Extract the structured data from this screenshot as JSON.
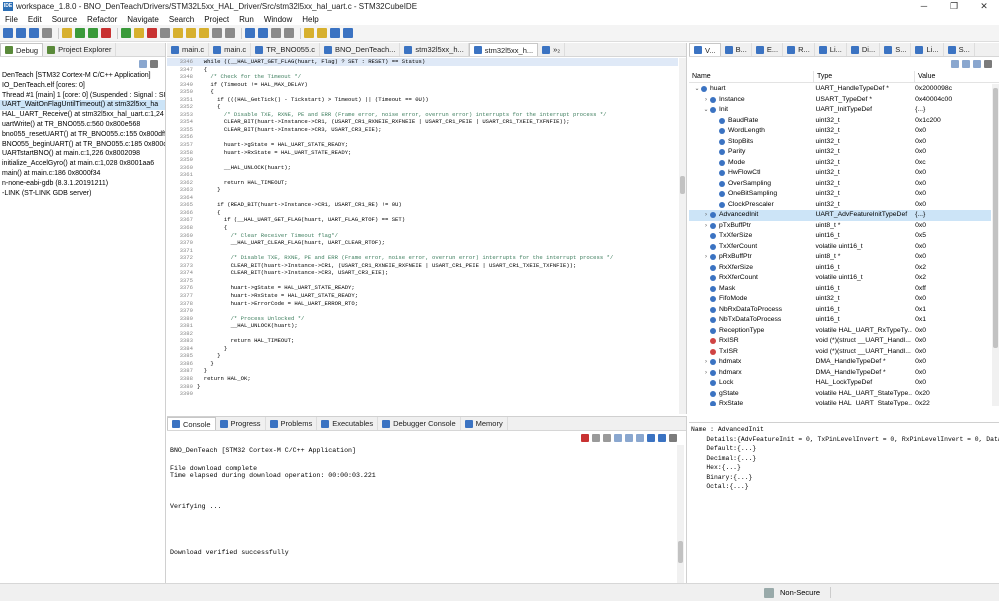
{
  "window": {
    "title": "workspace_1.8.0 - BNO_DenTeach/Drivers/STM32L5xx_HAL_Driver/Src/stm32l5xx_hal_uart.c - STM32CubeIDE",
    "app_icon": "IDE",
    "minimize": "─",
    "maximize": "❐",
    "close": "✕"
  },
  "menu": [
    "File",
    "Edit",
    "Source",
    "Refactor",
    "Navigate",
    "Search",
    "Project",
    "Run",
    "Window",
    "Help"
  ],
  "toolbar": {
    "icons": [
      "new-icon",
      "save-icon",
      "save-all-icon",
      "print-icon",
      "build-icon",
      "debug-icon",
      "run-icon",
      "external-tools-icon",
      "resume-icon",
      "suspend-icon",
      "terminate-icon",
      "disconnect-icon",
      "step-into-icon",
      "step-over-icon",
      "step-return-icon",
      "instruction-step-icon",
      "drop-frame-icon",
      "search-icon",
      "open-type-icon",
      "next-annotation-icon",
      "prev-annotation-icon",
      "back-icon",
      "forward-icon",
      "pin-icon",
      "info-icon"
    ],
    "colors": {
      "green": "#3a9a3a",
      "blue": "#3b73c2",
      "red": "#c83232",
      "yellow": "#d7b02e",
      "gray": "#8a8a8a"
    }
  },
  "debug_pane": {
    "tabs": [
      {
        "label": "Debug",
        "active": true
      },
      {
        "label": "Project Explorer",
        "active": false
      }
    ],
    "lines": [
      {
        "text": "DenTeach [STM32 Cortex-M C/C++ Application]",
        "selected": false
      },
      {
        "text": "IO_DenTeach.elf [cores: 0]",
        "selected": false
      },
      {
        "text": "Thread #1 [main] 1 [core: 0] (Suspended : Signal : SIG",
        "selected": false
      },
      {
        "text": "UART_WaitOnFlagUntilTimeout() at stm32l5xx_ha",
        "selected": true
      },
      {
        "text": "HAL_UART_Receive() at stm32l5xx_hal_uart.c:1,24",
        "selected": false
      },
      {
        "text": "uartWrite() at TR_BNO055.c:560 0x800e568",
        "selected": false
      },
      {
        "text": "bno055_resetUART() at TR_BNO055.c:155 0x800df5",
        "selected": false
      },
      {
        "text": "BNO055_beginUART() at TR_BNO055.c:185 0x800c",
        "selected": false
      },
      {
        "text": "UARTstartBNO() at main.c:1,226 0x8002098",
        "selected": false
      },
      {
        "text": "initialize_AccelGyro() at main.c:1,028 0x8001aa6",
        "selected": false
      },
      {
        "text": "main() at main.c:186 0x8000f34",
        "selected": false
      },
      {
        "text": "n-none-eabi-gdb (8.3.1.20191211)",
        "selected": false
      },
      {
        "text": "-LINK (ST-LINK GDB server)",
        "selected": false
      }
    ]
  },
  "editor": {
    "tabs": [
      {
        "label": "main.c",
        "active": false
      },
      {
        "label": "main.c",
        "active": false
      },
      {
        "label": "TR_BNO055.c",
        "active": false
      },
      {
        "label": "BNO_DenTeach...",
        "active": false
      },
      {
        "label": "stm32l5xx_h...",
        "active": false
      },
      {
        "label": "stm32l5xx_h...",
        "active": true
      },
      {
        "label": "»₂",
        "active": false
      }
    ],
    "lines": [
      {
        "n": "3346",
        "t": "  while ((__HAL_UART_GET_FLAG(huart, Flag) ? SET : RESET) == Status)",
        "hl": true
      },
      {
        "n": "3347",
        "t": "  {",
        "hl": false
      },
      {
        "n": "3348",
        "t": "    /* Check for the Timeout */",
        "hl": false
      },
      {
        "n": "3349",
        "t": "    if (Timeout != HAL_MAX_DELAY)",
        "hl": false
      },
      {
        "n": "3350",
        "t": "    {",
        "hl": false
      },
      {
        "n": "3351",
        "t": "      if (((HAL_GetTick() - Tickstart) > Timeout) || (Timeout == 0U))",
        "hl": false
      },
      {
        "n": "3352",
        "t": "      {",
        "hl": false
      },
      {
        "n": "3353",
        "t": "        /* Disable TXE, RXNE, PE and ERR (Frame error, noise error, overrun error) interrupts for the interrupt process */",
        "hl": false
      },
      {
        "n": "3354",
        "t": "        CLEAR_BIT(huart->Instance->CR1, (USART_CR1_RXNEIE_RXFNEIE | USART_CR1_PEIE | USART_CR1_TXEIE_TXFNFIE));",
        "hl": false
      },
      {
        "n": "3355",
        "t": "        CLEAR_BIT(huart->Instance->CR3, USART_CR3_EIE);",
        "hl": false
      },
      {
        "n": "3356",
        "t": "",
        "hl": false
      },
      {
        "n": "3357",
        "t": "        huart->gState = HAL_UART_STATE_READY;",
        "hl": false
      },
      {
        "n": "3358",
        "t": "        huart->RxState = HAL_UART_STATE_READY;",
        "hl": false
      },
      {
        "n": "3359",
        "t": "",
        "hl": false
      },
      {
        "n": "3360",
        "t": "        __HAL_UNLOCK(huart);",
        "hl": false
      },
      {
        "n": "3361",
        "t": "",
        "hl": false
      },
      {
        "n": "3362",
        "t": "        return HAL_TIMEOUT;",
        "hl": false
      },
      {
        "n": "3363",
        "t": "      }",
        "hl": false
      },
      {
        "n": "3364",
        "t": "",
        "hl": false
      },
      {
        "n": "3365",
        "t": "      if (READ_BIT(huart->Instance->CR1, USART_CR1_RE) != 0U)",
        "hl": false
      },
      {
        "n": "3366",
        "t": "      {",
        "hl": false
      },
      {
        "n": "3367",
        "t": "        if (__HAL_UART_GET_FLAG(huart, UART_FLAG_RTOF) == SET)",
        "hl": false
      },
      {
        "n": "3368",
        "t": "        {",
        "hl": false
      },
      {
        "n": "3369",
        "t": "          /* Clear Receiver Timeout flag*/",
        "hl": false
      },
      {
        "n": "3370",
        "t": "          __HAL_UART_CLEAR_FLAG(huart, UART_CLEAR_RTOF);",
        "hl": false
      },
      {
        "n": "3371",
        "t": "",
        "hl": false
      },
      {
        "n": "3372",
        "t": "          /* Disable TXE, RXNE, PE and ERR (Frame error, noise error, overrun error) interrupts for the interrupt process */",
        "hl": false
      },
      {
        "n": "3373",
        "t": "          CLEAR_BIT(huart->Instance->CR1, (USART_CR1_RXNEIE_RXFNEIE | USART_CR1_PEIE | USART_CR1_TXEIE_TXFNFIE));",
        "hl": false
      },
      {
        "n": "3374",
        "t": "          CLEAR_BIT(huart->Instance->CR3, USART_CR3_EIE);",
        "hl": false
      },
      {
        "n": "3375",
        "t": "",
        "hl": false
      },
      {
        "n": "3376",
        "t": "          huart->gState = HAL_UART_STATE_READY;",
        "hl": false
      },
      {
        "n": "3377",
        "t": "          huart->RxState = HAL_UART_STATE_READY;",
        "hl": false
      },
      {
        "n": "3378",
        "t": "          huart->ErrorCode = HAL_UART_ERROR_RTO;",
        "hl": false
      },
      {
        "n": "3379",
        "t": "",
        "hl": false
      },
      {
        "n": "3380",
        "t": "          /* Process Unlocked */",
        "hl": false
      },
      {
        "n": "3381",
        "t": "          __HAL_UNLOCK(huart);",
        "hl": false
      },
      {
        "n": "3382",
        "t": "",
        "hl": false
      },
      {
        "n": "3383",
        "t": "          return HAL_TIMEOUT;",
        "hl": false
      },
      {
        "n": "3384",
        "t": "        }",
        "hl": false
      },
      {
        "n": "3385",
        "t": "      }",
        "hl": false
      },
      {
        "n": "3386",
        "t": "    }",
        "hl": false
      },
      {
        "n": "3387",
        "t": "  }",
        "hl": false
      },
      {
        "n": "3388",
        "t": "  return HAL_OK;",
        "hl": false
      },
      {
        "n": "3389",
        "t": "}",
        "hl": false
      },
      {
        "n": "3390",
        "t": "",
        "hl": false
      }
    ]
  },
  "console": {
    "tabs": [
      {
        "label": "Console",
        "active": true
      },
      {
        "label": "Progress",
        "active": false
      },
      {
        "label": "Problems",
        "active": false
      },
      {
        "label": "Executables",
        "active": false
      },
      {
        "label": "Debugger Console",
        "active": false
      },
      {
        "label": "Memory",
        "active": false
      }
    ],
    "header": "BNO_DenTeach [STM32 Cortex-M C/C++ Application]",
    "lines": [
      "",
      "File download complete",
      "Time elapsed during download operation: 00:00:03.221",
      "",
      "",
      "",
      "Verifying ...",
      "",
      "",
      "",
      "",
      "",
      "Download verified successfully",
      ""
    ]
  },
  "variables": {
    "tabs": [
      {
        "label": "V...",
        "active": true
      },
      {
        "label": "B...",
        "active": false
      },
      {
        "label": "E...",
        "active": false
      },
      {
        "label": "R...",
        "active": false
      },
      {
        "label": "Li...",
        "active": false
      },
      {
        "label": "Di...",
        "active": false
      },
      {
        "label": "S...",
        "active": false
      },
      {
        "label": "Li...",
        "active": false
      },
      {
        "label": "S...",
        "active": false
      }
    ],
    "columns": [
      "Name",
      "Type",
      "Value"
    ],
    "rows": [
      {
        "depth": 0,
        "arrow": "⌄",
        "name": "huart",
        "type": "UART_HandleTypeDef *",
        "value": "0x2000098c",
        "icon": "#3b73c2",
        "sel": false
      },
      {
        "depth": 1,
        "arrow": "›",
        "name": "Instance",
        "type": "USART_TypeDef *",
        "value": "0x40004c00",
        "icon": "#3b73c2",
        "sel": false
      },
      {
        "depth": 1,
        "arrow": "⌄",
        "name": "Init",
        "type": "UART_InitTypeDef",
        "value": "{...}",
        "icon": "#3b73c2",
        "sel": false
      },
      {
        "depth": 2,
        "arrow": "",
        "name": "BaudRate",
        "type": "uint32_t",
        "value": "0x1c200",
        "icon": "#3b73c2",
        "sel": false
      },
      {
        "depth": 2,
        "arrow": "",
        "name": "WordLength",
        "type": "uint32_t",
        "value": "0x0",
        "icon": "#3b73c2",
        "sel": false
      },
      {
        "depth": 2,
        "arrow": "",
        "name": "StopBits",
        "type": "uint32_t",
        "value": "0x0",
        "icon": "#3b73c2",
        "sel": false
      },
      {
        "depth": 2,
        "arrow": "",
        "name": "Parity",
        "type": "uint32_t",
        "value": "0x0",
        "icon": "#3b73c2",
        "sel": false
      },
      {
        "depth": 2,
        "arrow": "",
        "name": "Mode",
        "type": "uint32_t",
        "value": "0xc",
        "icon": "#3b73c2",
        "sel": false
      },
      {
        "depth": 2,
        "arrow": "",
        "name": "HwFlowCtl",
        "type": "uint32_t",
        "value": "0x0",
        "icon": "#3b73c2",
        "sel": false
      },
      {
        "depth": 2,
        "arrow": "",
        "name": "OverSampling",
        "type": "uint32_t",
        "value": "0x0",
        "icon": "#3b73c2",
        "sel": false
      },
      {
        "depth": 2,
        "arrow": "",
        "name": "OneBitSampling",
        "type": "uint32_t",
        "value": "0x0",
        "icon": "#3b73c2",
        "sel": false
      },
      {
        "depth": 2,
        "arrow": "",
        "name": "ClockPrescaler",
        "type": "uint32_t",
        "value": "0x0",
        "icon": "#3b73c2",
        "sel": false
      },
      {
        "depth": 1,
        "arrow": "›",
        "name": "AdvancedInit",
        "type": "UART_AdvFeatureInitTypeDef",
        "value": "{...}",
        "icon": "#3b73c2",
        "sel": true
      },
      {
        "depth": 1,
        "arrow": "›",
        "name": "pTxBuffPtr",
        "type": "uint8_t *",
        "value": "0x0",
        "icon": "#3b73c2",
        "sel": false
      },
      {
        "depth": 1,
        "arrow": "",
        "name": "TxXferSize",
        "type": "uint16_t",
        "value": "0x5",
        "icon": "#3b73c2",
        "sel": false
      },
      {
        "depth": 1,
        "arrow": "",
        "name": "TxXferCount",
        "type": "volatile uint16_t",
        "value": "0x0",
        "icon": "#3b73c2",
        "sel": false
      },
      {
        "depth": 1,
        "arrow": "›",
        "name": "pRxBuffPtr",
        "type": "uint8_t *",
        "value": "0x0",
        "icon": "#3b73c2",
        "sel": false
      },
      {
        "depth": 1,
        "arrow": "",
        "name": "RxXferSize",
        "type": "uint16_t",
        "value": "0x2",
        "icon": "#3b73c2",
        "sel": false
      },
      {
        "depth": 1,
        "arrow": "",
        "name": "RxXferCount",
        "type": "volatile uint16_t",
        "value": "0x2",
        "icon": "#3b73c2",
        "sel": false
      },
      {
        "depth": 1,
        "arrow": "",
        "name": "Mask",
        "type": "uint16_t",
        "value": "0xff",
        "icon": "#3b73c2",
        "sel": false
      },
      {
        "depth": 1,
        "arrow": "",
        "name": "FifoMode",
        "type": "uint32_t",
        "value": "0x0",
        "icon": "#3b73c2",
        "sel": false
      },
      {
        "depth": 1,
        "arrow": "",
        "name": "NbRxDataToProcess",
        "type": "uint16_t",
        "value": "0x1",
        "icon": "#3b73c2",
        "sel": false
      },
      {
        "depth": 1,
        "arrow": "",
        "name": "NbTxDataToProcess",
        "type": "uint16_t",
        "value": "0x1",
        "icon": "#3b73c2",
        "sel": false
      },
      {
        "depth": 1,
        "arrow": "",
        "name": "ReceptionType",
        "type": "volatile HAL_UART_RxTypeTy...",
        "value": "0x0",
        "icon": "#3b73c2",
        "sel": false
      },
      {
        "depth": 1,
        "arrow": "",
        "name": "RxISR",
        "type": "void (*)(struct __UART_Handl...",
        "value": "0x0",
        "icon": "#d04444",
        "sel": false
      },
      {
        "depth": 1,
        "arrow": "",
        "name": "TxISR",
        "type": "void (*)(struct __UART_Handl...",
        "value": "0x0",
        "icon": "#d04444",
        "sel": false
      },
      {
        "depth": 1,
        "arrow": "›",
        "name": "hdmatx",
        "type": "DMA_HandleTypeDef *",
        "value": "0x0",
        "icon": "#3b73c2",
        "sel": false
      },
      {
        "depth": 1,
        "arrow": "›",
        "name": "hdmarx",
        "type": "DMA_HandleTypeDef *",
        "value": "0x0",
        "icon": "#3b73c2",
        "sel": false
      },
      {
        "depth": 1,
        "arrow": "",
        "name": "Lock",
        "type": "HAL_LockTypeDef",
        "value": "0x0",
        "icon": "#3b73c2",
        "sel": false
      },
      {
        "depth": 1,
        "arrow": "",
        "name": "gState",
        "type": "volatile HAL_UART_StateType...",
        "value": "0x20",
        "icon": "#3b73c2",
        "sel": false
      },
      {
        "depth": 1,
        "arrow": "",
        "name": "RxState",
        "type": "volatile HAL_UART_StateType...",
        "value": "0x22",
        "icon": "#3b73c2",
        "sel": false
      }
    ],
    "detail": [
      "Name : AdvancedInit",
      "    Details:{AdvFeatureInit = 0, TxPinLevelInvert = 0, RxPinLevelInvert = 0, DataInv",
      "    Default:{...}",
      "    Decimal:{...}",
      "    Hex:{...}",
      "    Binary:{...}",
      "    Octal:{...}"
    ]
  },
  "status": {
    "security": "Non-Secure"
  }
}
